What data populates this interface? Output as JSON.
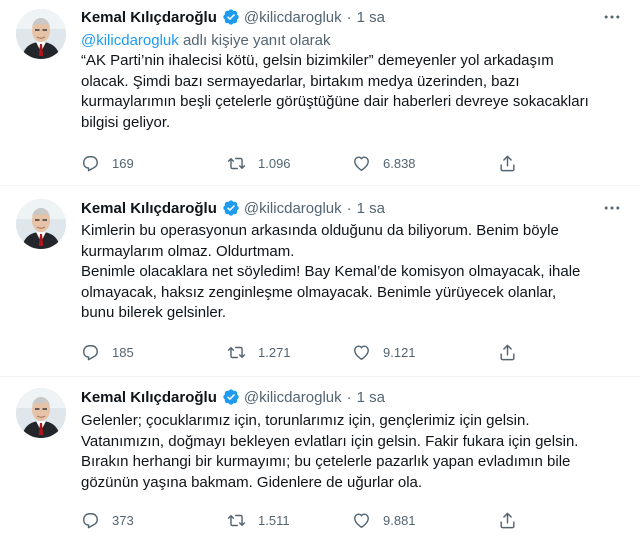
{
  "tweets": [
    {
      "name": "Kemal Kılıçdaroğlu",
      "handle": "@kilicdarogluk",
      "dot": "·",
      "time": "1 sa",
      "reply_handle": "@kilicdarogluk",
      "reply_suffix": "adlı kişiye yanıt olarak",
      "lines": [
        "“AK Parti’nin ihalecisi kötü, gelsin bizimkiler” demeyenler yol arkadaşım",
        "olacak. Şimdi bazı sermayedarlar, birtakım medya üzerinden, bazı",
        "kurmaylarımın beşli çetelerle görüştüğüne dair haberleri devreye sokacakları",
        "bilgisi geliyor."
      ],
      "replies": "169",
      "retweets": "1.096",
      "likes": "6.838"
    },
    {
      "name": "Kemal Kılıçdaroğlu",
      "handle": "@kilicdarogluk",
      "dot": "·",
      "time": "1 sa",
      "lines": [
        "Kimlerin bu operasyonun arkasında olduğunu da biliyorum. Benim böyle",
        "kurmaylarım olmaz. Oldurtmam.",
        "Benimle olacaklara net söyledim! Bay Kemal’de komisyon olmayacak, ihale",
        "olmayacak, haksız zenginleşme olmayacak. Benimle yürüyecek olanlar,",
        "bunu bilerek gelsinler."
      ],
      "replies": "185",
      "retweets": "1.271",
      "likes": "9.121"
    },
    {
      "name": "Kemal Kılıçdaroğlu",
      "handle": "@kilicdarogluk",
      "dot": "·",
      "time": "1 sa",
      "lines": [
        "Gelenler; çocuklarımız için, torunlarımız için, gençlerimiz için gelsin.",
        "Vatanımızın, doğmayı bekleyen evlatları için gelsin. Fakir fukara için gelsin.",
        "Bırakın herhangi bir kurmayımı; bu çetelerle pazarlık yapan evladımın bile",
        "gözünün yaşına bakmam. Gidenlere de uğurlar ola."
      ],
      "replies": "373",
      "retweets": "1.511",
      "likes": "9.881"
    }
  ],
  "colors": {
    "text": "#0f1419",
    "secondary": "#536471",
    "link": "#1d9bf0",
    "verified": "#1d9bf0",
    "separator": "#eff3f4"
  },
  "icons": [
    "verified-badge-icon",
    "more-icon",
    "reply-icon",
    "retweet-icon",
    "like-icon",
    "share-icon"
  ]
}
